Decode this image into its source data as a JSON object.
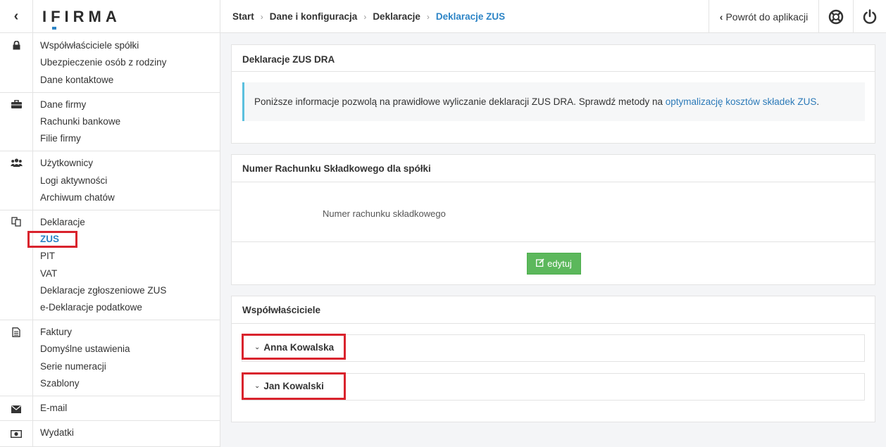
{
  "app": {
    "logo": "IFIRMA"
  },
  "breadcrumb": [
    {
      "label": "Start"
    },
    {
      "label": "Dane i konfiguracja"
    },
    {
      "label": "Deklaracje"
    },
    {
      "label": "Deklaracje ZUS"
    }
  ],
  "topbar": {
    "return_label": "Powrót do aplikacji",
    "back_glyph": "‹",
    "chevron_glyph": "‹",
    "sep_glyph": "›"
  },
  "sidebar": {
    "sections": [
      {
        "icon": "lock-icon",
        "items": [
          "Współwłaściciele spółki",
          "Ubezpieczenie osób z rodziny",
          "Dane kontaktowe"
        ]
      },
      {
        "icon": "briefcase-icon",
        "items": [
          "Dane firmy",
          "Rachunki bankowe",
          "Filie firmy"
        ]
      },
      {
        "icon": "users-icon",
        "items": [
          "Użytkownicy",
          "Logi aktywności",
          "Archiwum chatów"
        ]
      },
      {
        "icon": "documents-icon",
        "items": [
          "Deklaracje",
          "ZUS",
          "PIT",
          "VAT",
          "Deklaracje zgłoszeniowe ZUS",
          "e-Deklaracje podatkowe"
        ]
      },
      {
        "icon": "invoice-icon",
        "items": [
          "Faktury",
          "Domyślne ustawienia",
          "Serie numeracji",
          "Szablony"
        ]
      },
      {
        "icon": "envelope-icon",
        "items": [
          "E-mail"
        ]
      },
      {
        "icon": "money-icon",
        "items": [
          "Wydatki"
        ]
      }
    ],
    "active_item": "ZUS"
  },
  "main": {
    "panel_dra": {
      "title": "Deklaracje ZUS DRA",
      "info_text": "Poniższe informacje pozwolą na prawidłowe wyliczanie deklaracji ZUS DRA. Sprawdź metody na ",
      "info_link": "optymalizację kosztów składek ZUS",
      "info_end": "."
    },
    "panel_account": {
      "title": "Numer Rachunku Składkowego dla spółki",
      "field_label": "Numer rachunku składkowego",
      "edit_label": "edytuj"
    },
    "panel_owners": {
      "title": "Współwłaściciele",
      "owners": [
        "Anna Kowalska",
        "Jan Kowalski"
      ],
      "expand_glyph": "⌄"
    }
  },
  "colors": {
    "accent": "#2c84c6",
    "success": "#5cb85c",
    "highlight": "#d9232d",
    "info_border": "#5bc0de"
  }
}
